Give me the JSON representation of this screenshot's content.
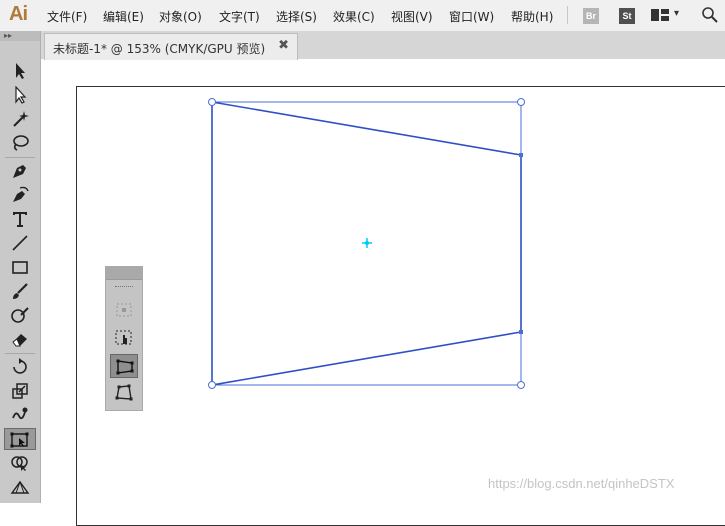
{
  "app": {
    "logo": "Ai"
  },
  "menu": {
    "items": [
      {
        "label": "文件(F)",
        "name": "menu-file"
      },
      {
        "label": "编辑(E)",
        "name": "menu-edit"
      },
      {
        "label": "对象(O)",
        "name": "menu-object"
      },
      {
        "label": "文字(T)",
        "name": "menu-type"
      },
      {
        "label": "选择(S)",
        "name": "menu-select"
      },
      {
        "label": "效果(C)",
        "name": "menu-effect"
      },
      {
        "label": "视图(V)",
        "name": "menu-view"
      },
      {
        "label": "窗口(W)",
        "name": "menu-window"
      },
      {
        "label": "帮助(H)",
        "name": "menu-help"
      }
    ],
    "bridge_label": "Br",
    "stock_label": "St",
    "workspace_icon": "workspace-grid-icon",
    "chevron": "▾"
  },
  "tab": {
    "title": "未标题-1* @ 153% (CMYK/GPU 预览)",
    "close": "✖"
  },
  "toolbar": {
    "collapse": "▸▸",
    "tools": [
      "selection-tool",
      "direct-selection-tool",
      "magic-wand-tool",
      "lasso-tool",
      "pen-tool",
      "curvature-tool",
      "type-tool",
      "line-segment-tool",
      "rectangle-tool",
      "paintbrush-tool",
      "shaper-tool",
      "eraser-tool",
      "rotate-tool",
      "scale-tool",
      "warp-tool",
      "free-transform-tool",
      "shape-builder-tool",
      "perspective-grid-tool"
    ],
    "active_tool": "free-transform-tool"
  },
  "flyout": {
    "tools": [
      "constrain-tool",
      "free-transform-sub-tool",
      "perspective-distort-tool",
      "free-distort-tool"
    ],
    "active": "perspective-distort-tool"
  },
  "colors": {
    "selection": "#4a6fd9",
    "center_point": "#00c8ff",
    "logo": "#b07a3c"
  },
  "watermark": "https://blog.csdn.net/qinheDSTX"
}
